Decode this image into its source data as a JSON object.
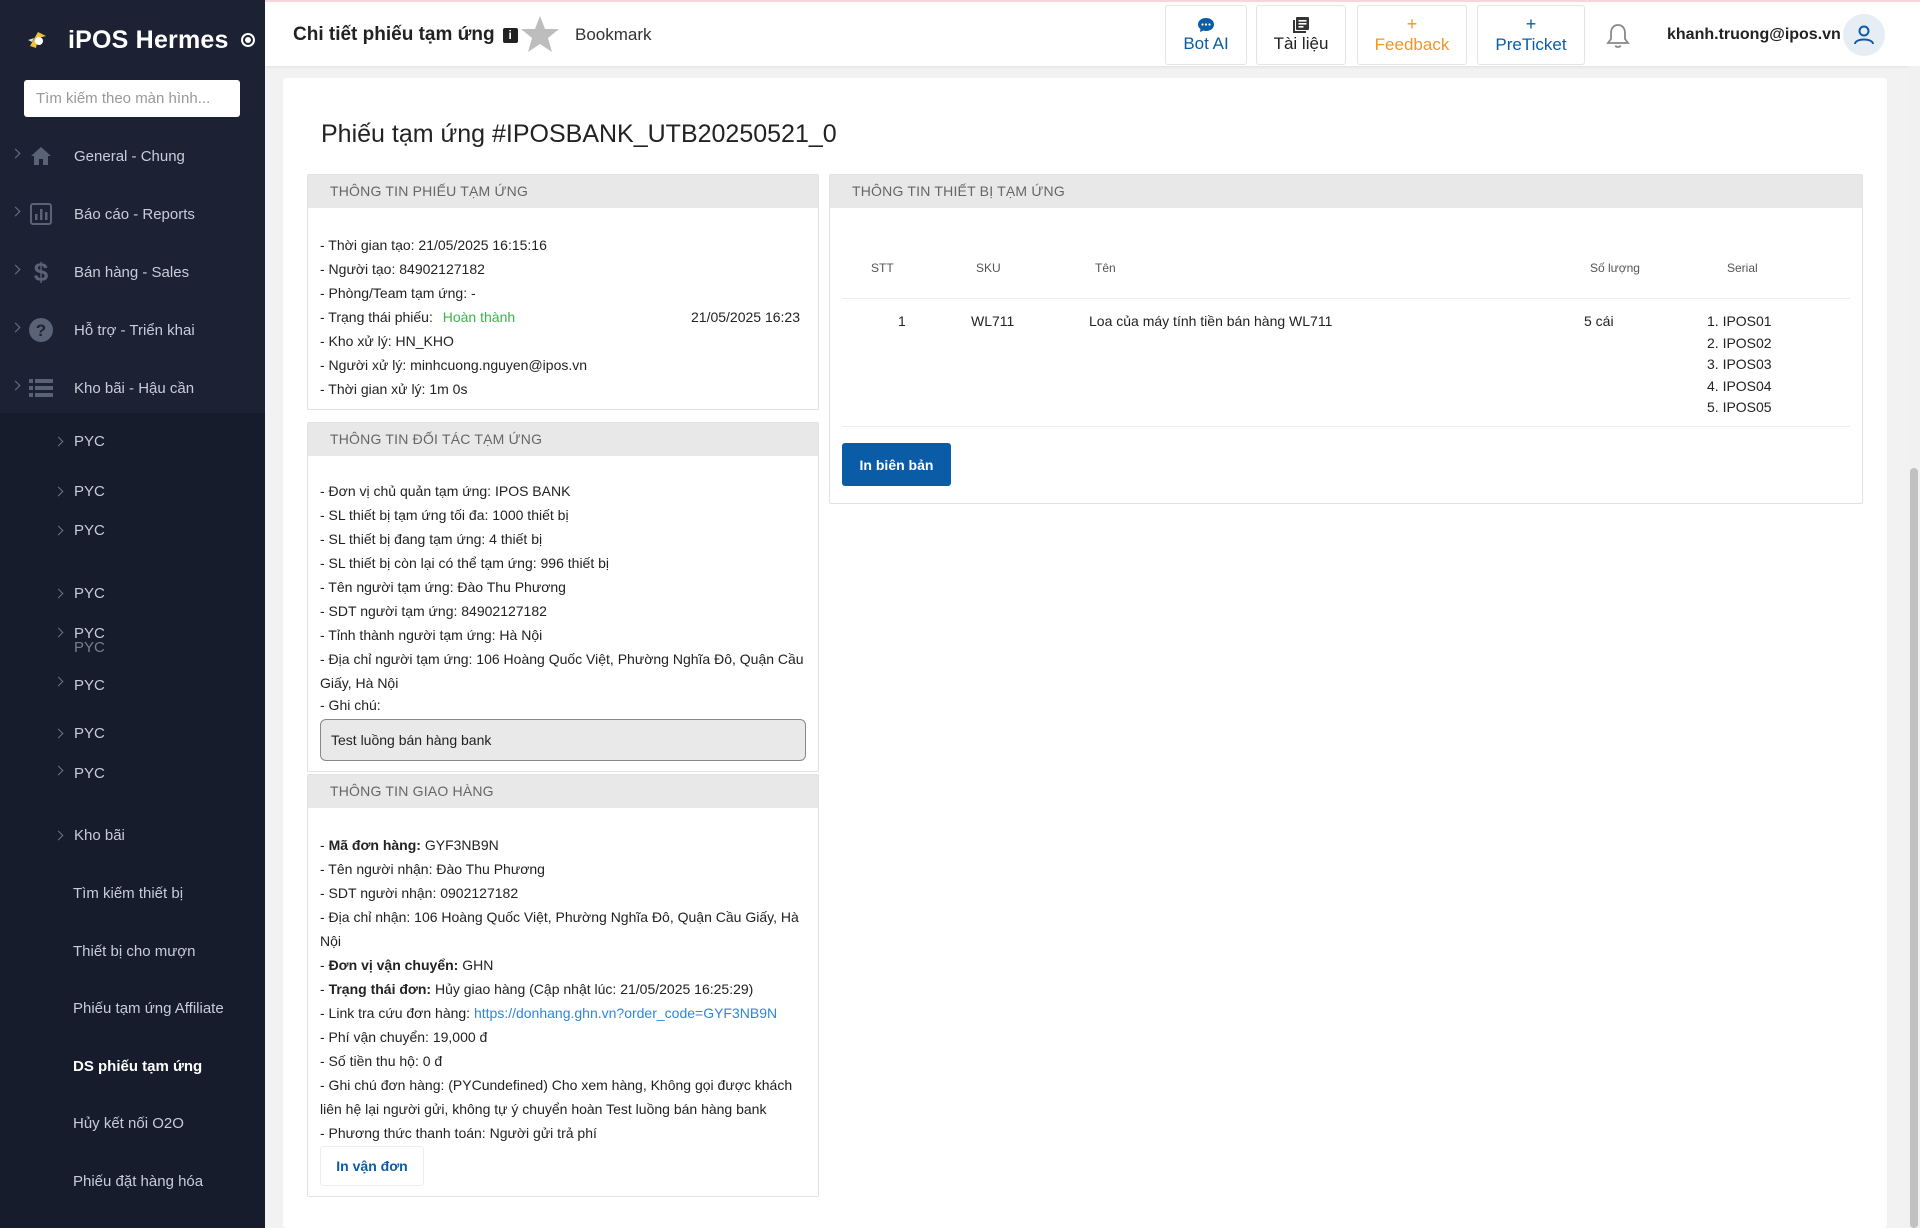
{
  "sidebar": {
    "app_name": "iPOS Hermes",
    "search_placeholder": "Tìm kiếm theo màn hình...",
    "menu": [
      {
        "label": "General - Chung",
        "icon": "home-icon"
      },
      {
        "label": "Báo cáo - Reports",
        "icon": "report-icon"
      },
      {
        "label": "Bán hàng - Sales",
        "icon": "dollar-icon"
      },
      {
        "label": "Hỗ trợ - Triển khai",
        "icon": "help-icon"
      },
      {
        "label": "Kho bãi - Hậu cần",
        "icon": "list-icon"
      }
    ],
    "sub": {
      "pyc": "PYC",
      "kho_bai": "Kho bãi",
      "tim_kiem": "Tìm kiếm thiết bị",
      "thiet_bi_cho_muon": "Thiết bị cho mượn",
      "phieu_affiliate": "Phiếu tạm ứng Affiliate",
      "ds_phieu": "DS phiếu tạm ứng",
      "huy_o2o": "Hủy kết nối O2O",
      "phieu_dat_hang": "Phiếu đặt hàng hóa"
    }
  },
  "header": {
    "title": "Chi tiết phiếu tạm ứng",
    "info_glyph": "i",
    "bookmark": "Bookmark",
    "bot_ai": "Bot AI",
    "tai_lieu": "Tài liệu",
    "feedback": "Feedback",
    "preticket": "PreTicket",
    "plus": "+",
    "user_email": "khanh.truong@ipos.vn"
  },
  "colors": {
    "accent_blue": "#0b5ca6",
    "feedback_orange": "#f0962a",
    "status_green": "#3bb54a",
    "sidebar_bg": "#1c2233"
  },
  "page": {
    "title": "Phiếu tạm ứng #IPOSBANK_UTB20250521_0"
  },
  "info": {
    "heading": "THÔNG TIN PHIẾU TẠM ỨNG",
    "created_time": "- Thời gian tạo: 21/05/2025 16:15:16",
    "creator": "- Người tạo: 84902127182",
    "team": "- Phòng/Team tạm ứng: -",
    "status_label": "- Trạng thái phiếu:",
    "status_value": "Hoàn thành",
    "status_time": "21/05/2025 16:23",
    "warehouse": "- Kho xử lý: HN_KHO",
    "handler": "- Người xử lý: minhcuong.nguyen@ipos.vn",
    "process_time": "- Thời gian xử lý: 1m 0s"
  },
  "partner": {
    "heading": "THÔNG TIN ĐỐI TÁC TẠM ỨNG",
    "owner": "- Đơn vị chủ quản tạm ứng: IPOS BANK",
    "max": "- SL thiết bị tạm ứng tối đa: 1000 thiết bị",
    "current": "- SL thiết bị đang tạm ứng: 4 thiết bị",
    "remaining": "- SL thiết bị còn lại có thể tạm ứng: 996 thiết bị",
    "name": "- Tên người tạm ứng: Đào Thu Phương",
    "phone": "- SDT người tạm ứng: 84902127182",
    "province": "- Tỉnh thành người tạm ứng: Hà Nội",
    "address1": "- Địa chỉ người tạm ứng: 106 Hoàng Quốc Việt, Phường Nghĩa Đô, Quận Cầu",
    "address2": "Giấy, Hà Nội",
    "note_label": "- Ghi chú:",
    "note_value": "Test luồng bán hàng bank"
  },
  "delivery": {
    "heading": "THÔNG TIN GIAO HÀNG",
    "order_code_label": "Mã đơn hàng:",
    "order_code": "GYF3NB9N",
    "receiver": "- Tên người nhận: Đào Thu Phương",
    "receiver_phone": "- SDT người nhận: 0902127182",
    "address1": "- Địa chỉ nhận: 106 Hoàng Quốc Việt, Phường Nghĩa Đô, Quận Cầu Giấy, Hà",
    "address2": "Nội",
    "carrier_label": "Đơn vị vận chuyển:",
    "carrier": "GHN",
    "status_label": "Trạng thái đơn:",
    "status": "Hủy giao hàng (Cập nhật lúc: 21/05/2025 16:25:29)",
    "tracking_label": "- Link tra cứu đơn hàng:",
    "tracking_url": "https://donhang.ghn.vn?order_code=GYF3NB9N",
    "fee": "- Phí vận chuyển: 19,000 đ",
    "cod": "- Số tiền thu hộ: 0 đ",
    "note1": "- Ghi chú đơn hàng: (PYCundefined) Cho xem hàng, Không gọi được khách",
    "note2": "liên hệ lại người gửi, không tự ý chuyển hoàn Test luồng bán hàng bank",
    "payment": "- Phương thức thanh toán: Người gửi trả phí",
    "print_button": "In vận đơn",
    "dash": "- "
  },
  "devices": {
    "heading": "THÔNG TIN THIẾT BỊ TẠM ỨNG",
    "columns": [
      "STT",
      "SKU",
      "Tên",
      "Số lượng",
      "Serial"
    ],
    "rows": [
      {
        "stt": "1",
        "sku": "WL711",
        "name": "Loa của máy tính tiền bán hàng WL711",
        "qty": "5 cái",
        "serials": [
          "1. IPOS01",
          "2. IPOS02",
          "3. IPOS03",
          "4. IPOS04",
          "5. IPOS05"
        ]
      }
    ],
    "print_button": "In biên bản"
  }
}
